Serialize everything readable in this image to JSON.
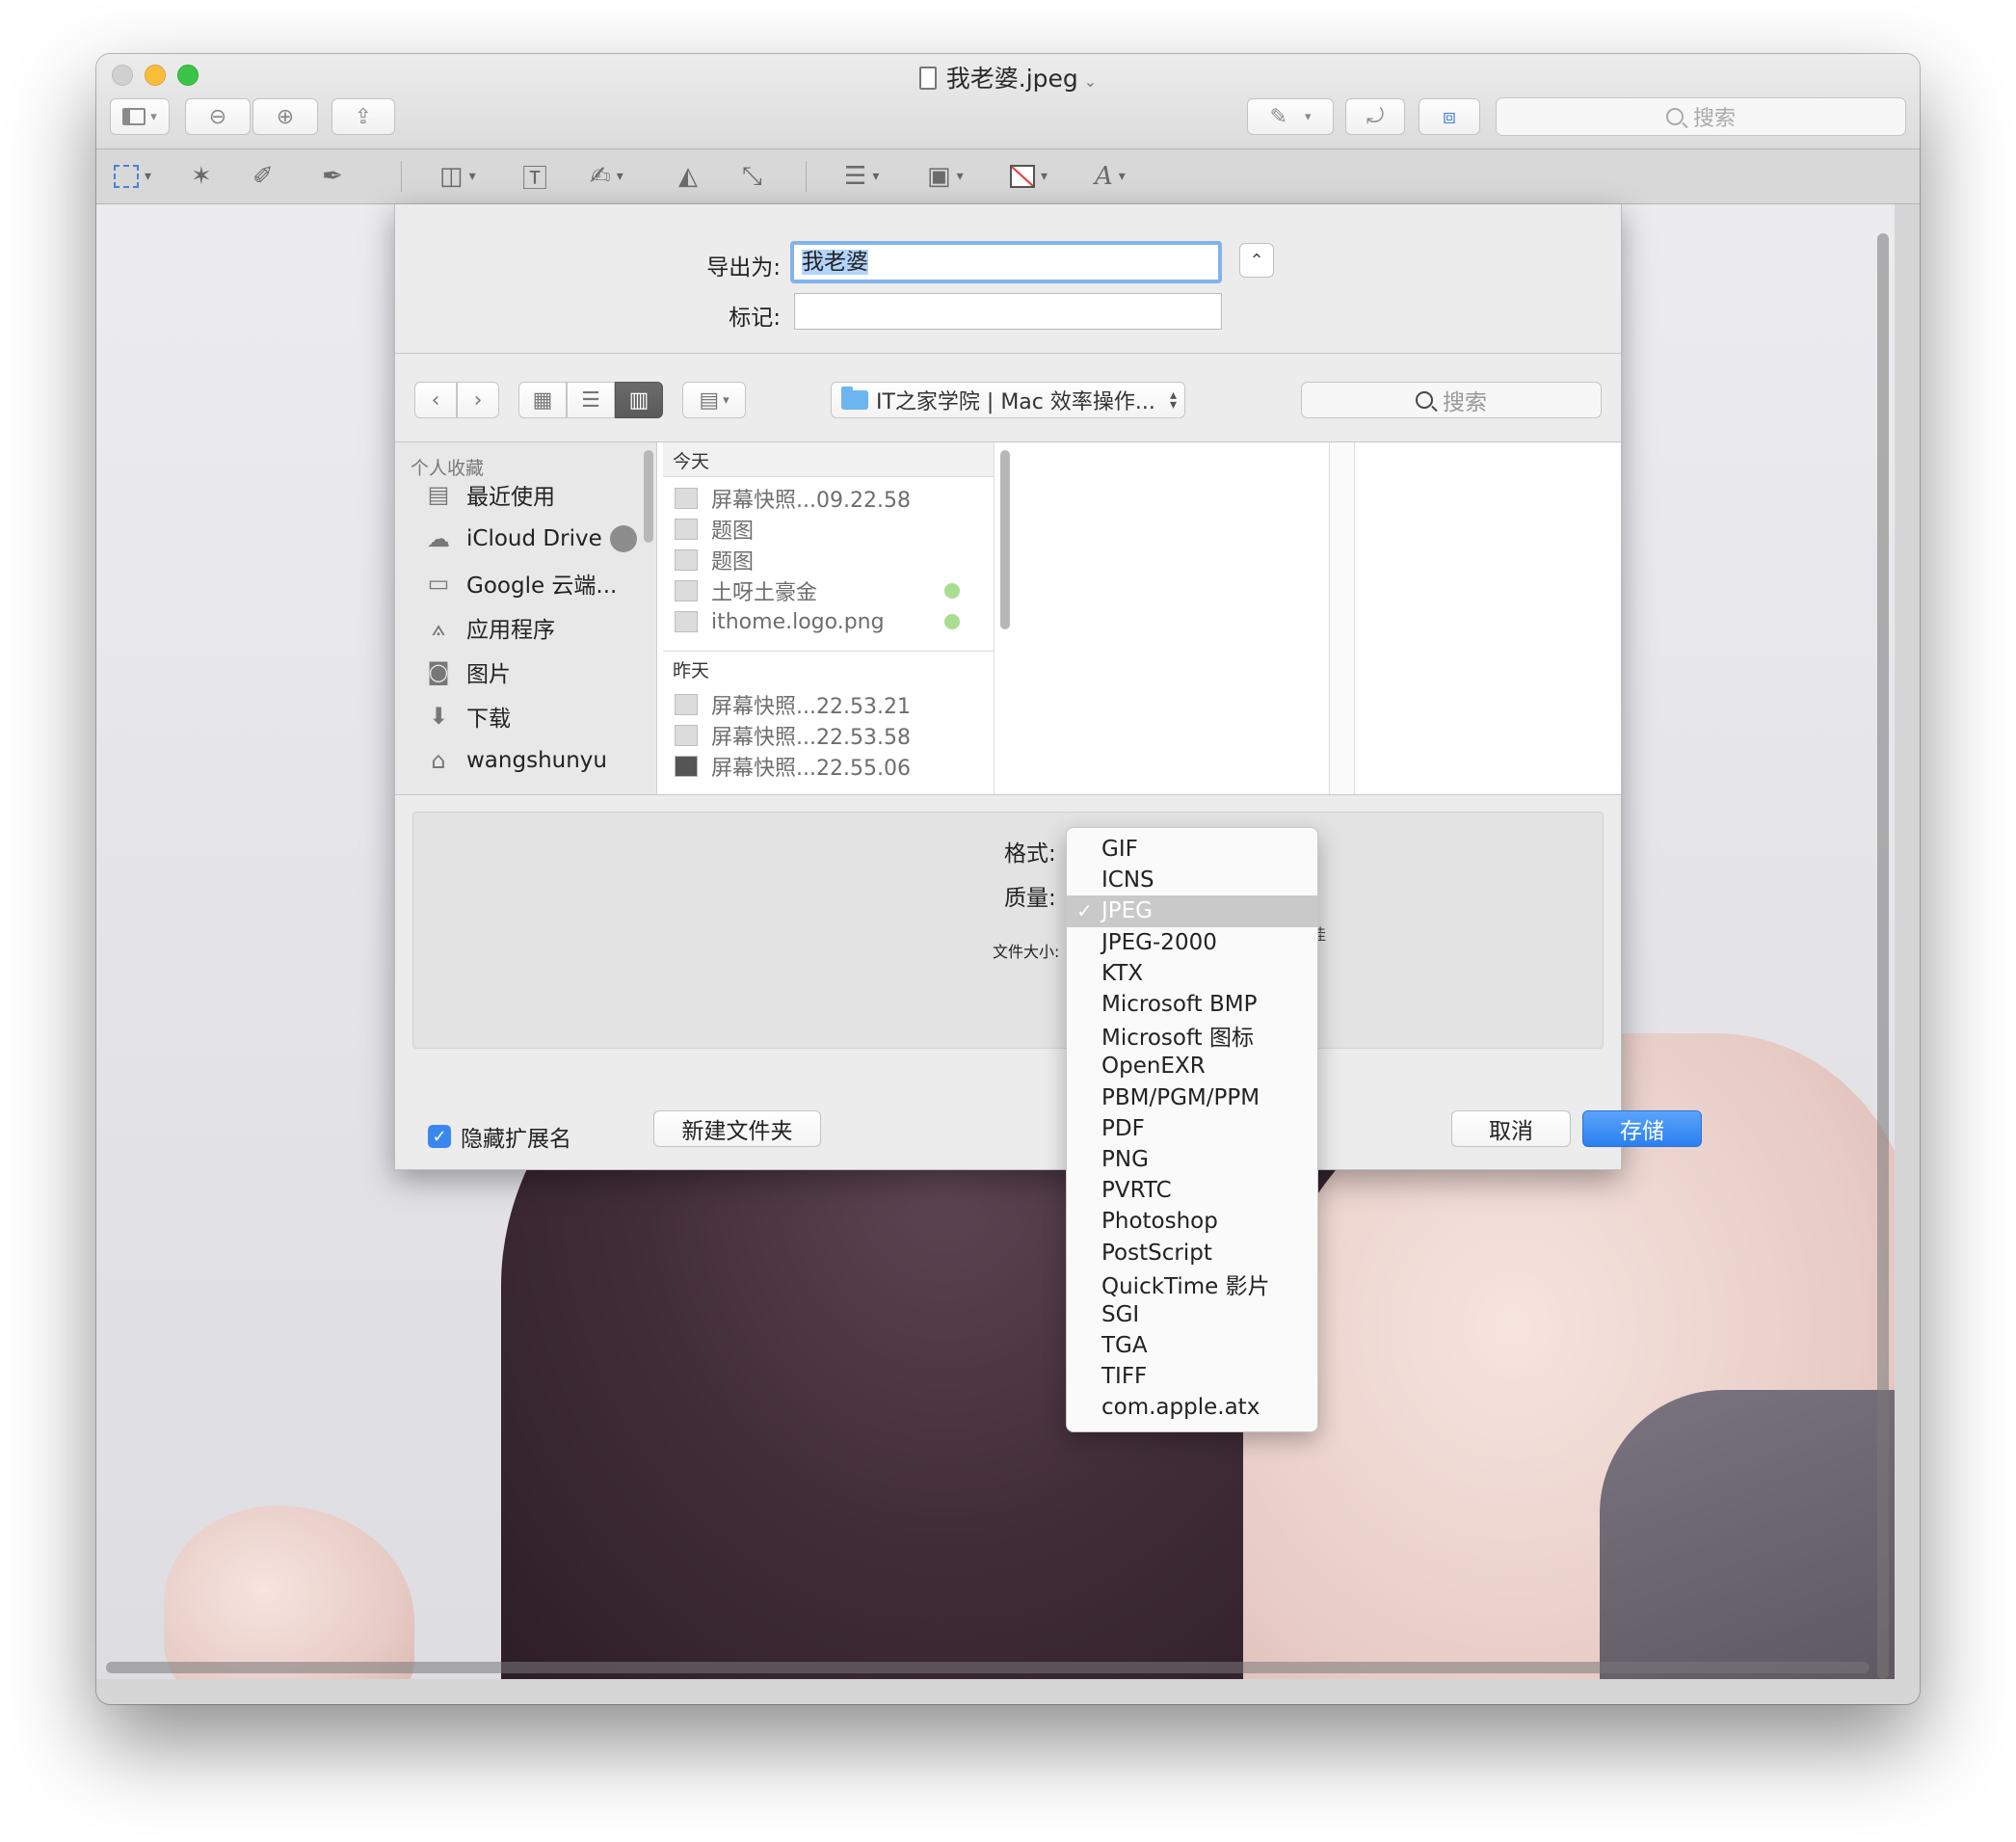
{
  "window": {
    "title": "我老婆.jpeg",
    "search_placeholder": "搜索"
  },
  "toolbar": {
    "sidebar_icon": "sidebar-icon",
    "zoom_out_icon": "zoom-out-icon",
    "zoom_in_icon": "zoom-in-icon",
    "share_icon": "share-icon",
    "markup_pen_icon": "pen-icon",
    "rotate_icon": "rotate-icon",
    "toolbox_icon": "toolbox-icon"
  },
  "markup": {
    "tools": [
      "selection-icon",
      "instant-alpha-icon",
      "sketch-icon",
      "draw-icon",
      "shapes-icon",
      "text-icon",
      "sign-icon",
      "adjust-color-icon",
      "adjust-size-icon",
      "line-style-icon",
      "border-color-icon",
      "fill-color-icon",
      "text-style-icon"
    ]
  },
  "sheet": {
    "export_as_label": "导出为:",
    "filename": "我老婆",
    "tags_label": "标记:",
    "path": "IT之家学院 | Mac 效率操作...",
    "search_placeholder": "搜索",
    "sidebar": {
      "header": "个人收藏",
      "items": [
        {
          "label": "最近使用",
          "icon": "recents-icon"
        },
        {
          "label": "iCloud Drive",
          "icon": "cloud-icon"
        },
        {
          "label": "Google 云端...",
          "icon": "folder-icon"
        },
        {
          "label": "应用程序",
          "icon": "applications-icon"
        },
        {
          "label": "图片",
          "icon": "camera-icon"
        },
        {
          "label": "下载",
          "icon": "download-icon"
        },
        {
          "label": "wangshunyu",
          "icon": "home-icon"
        }
      ]
    },
    "files": {
      "today_header": "今天",
      "today": [
        {
          "name": "屏幕快照...09.22.58",
          "tag": false
        },
        {
          "name": "题图",
          "tag": false
        },
        {
          "name": "题图",
          "tag": false
        },
        {
          "name": "土呀土豪金",
          "tag": true
        },
        {
          "name": "ithome.logo.png",
          "tag": true
        }
      ],
      "yesterday_header": "昨天",
      "yesterday": [
        {
          "name": "屏幕快照...22.53.21"
        },
        {
          "name": "屏幕快照...22.53.58"
        },
        {
          "name": "屏幕快照...22.55.06"
        }
      ]
    },
    "options": {
      "format_label": "格式:",
      "quality_label": "质量:",
      "filesize_label": "文件大小:",
      "partial_text": "佳"
    },
    "hide_extension_label": "隐藏扩展名",
    "hide_extension_checked": true,
    "new_folder_label": "新建文件夹",
    "cancel_label": "取消",
    "save_label": "存储",
    "accent_color": "#2a7ff0"
  },
  "format_menu": {
    "selected": "JPEG",
    "items": [
      "GIF",
      "ICNS",
      "JPEG",
      "JPEG-2000",
      "KTX",
      "Microsoft BMP",
      "Microsoft 图标",
      "OpenEXR",
      "PBM/PGM/PPM",
      "PDF",
      "PNG",
      "PVRTC",
      "Photoshop",
      "PostScript",
      "QuickTime 影片",
      "SGI",
      "TGA",
      "TIFF",
      "com.apple.atx"
    ]
  }
}
